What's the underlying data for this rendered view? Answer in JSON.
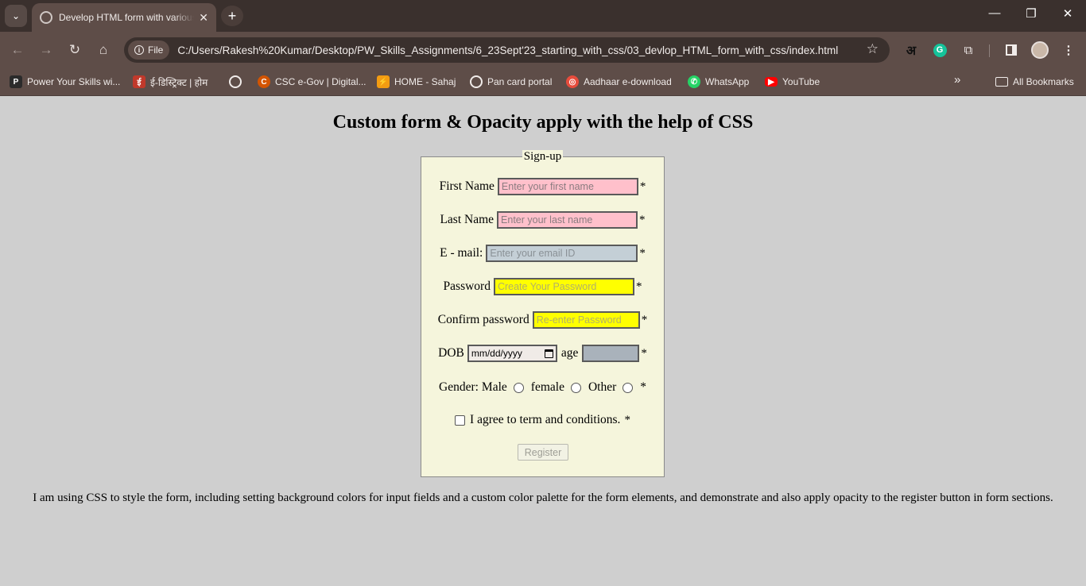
{
  "browser": {
    "tab_title": "Develop HTML form with various",
    "site_info_label": "File",
    "url": "C:/Users/Rakesh%20Kumar/Desktop/PW_Skills_Assignments/6_23Sept'23_starting_with_css/03_devlop_HTML_form_with_css/index.html",
    "ext_hindi": "अ",
    "ext_grammarly": "G"
  },
  "bookmarks": {
    "items": [
      {
        "label": "Power Your Skills wi...",
        "icon": "pw-skills-icon",
        "color": "#2b2b2b"
      },
      {
        "label": "ई-डिस्ट्रिक्ट | होम",
        "icon": "edistrict-icon",
        "color": "#c0392b"
      },
      {
        "label": "",
        "icon": "globe-icon",
        "color": "#5e4d48"
      },
      {
        "label": "CSC e-Gov | Digital...",
        "icon": "csc-icon",
        "color": "#d35400"
      },
      {
        "label": "HOME - Sahaj",
        "icon": "sahaj-icon",
        "color": "#f39c12"
      },
      {
        "label": "Pan card portal",
        "icon": "globe-icon",
        "color": "#5e4d48"
      },
      {
        "label": "Aadhaar e-download",
        "icon": "aadhaar-icon",
        "color": "#e74c3c"
      },
      {
        "label": "WhatsApp",
        "icon": "whatsapp-icon",
        "color": "#25d366"
      },
      {
        "label": "YouTube",
        "icon": "youtube-icon",
        "color": "#ff0000"
      }
    ],
    "all_label": "All Bookmarks"
  },
  "page": {
    "title": "Custom form & Opacity apply with the help of CSS",
    "legend": "Sign-up",
    "first_name": {
      "label": "First Name",
      "placeholder": "Enter your first name"
    },
    "last_name": {
      "label": "Last Name",
      "placeholder": "Enter your last name"
    },
    "email": {
      "label": "E - mail:",
      "placeholder": "Enter your email ID"
    },
    "password": {
      "label": "Password",
      "placeholder": "Create Your Password"
    },
    "confirm": {
      "label": "Confirm password",
      "placeholder": "Re-enter Password"
    },
    "dob": {
      "label": "DOB",
      "placeholder": "mm/dd/yyyy"
    },
    "age": {
      "label": "age"
    },
    "gender": {
      "label": "Gender:",
      "male": "Male",
      "female": "female",
      "other": "Other"
    },
    "agree": "I agree to term and conditions.",
    "required_mark": "*",
    "register": "Register",
    "description": "I am using CSS to style the form, including setting background colors for input fields and a custom color palette for the form elements, and demonstrate and also apply opacity to the register button in form sections."
  },
  "colors": {
    "pink_input": "#ffc0cb",
    "email_input": "#c4cfd6",
    "password_input": "#ffff00",
    "form_bg": "#f5f5dc",
    "page_bg": "#cfcfcf"
  }
}
